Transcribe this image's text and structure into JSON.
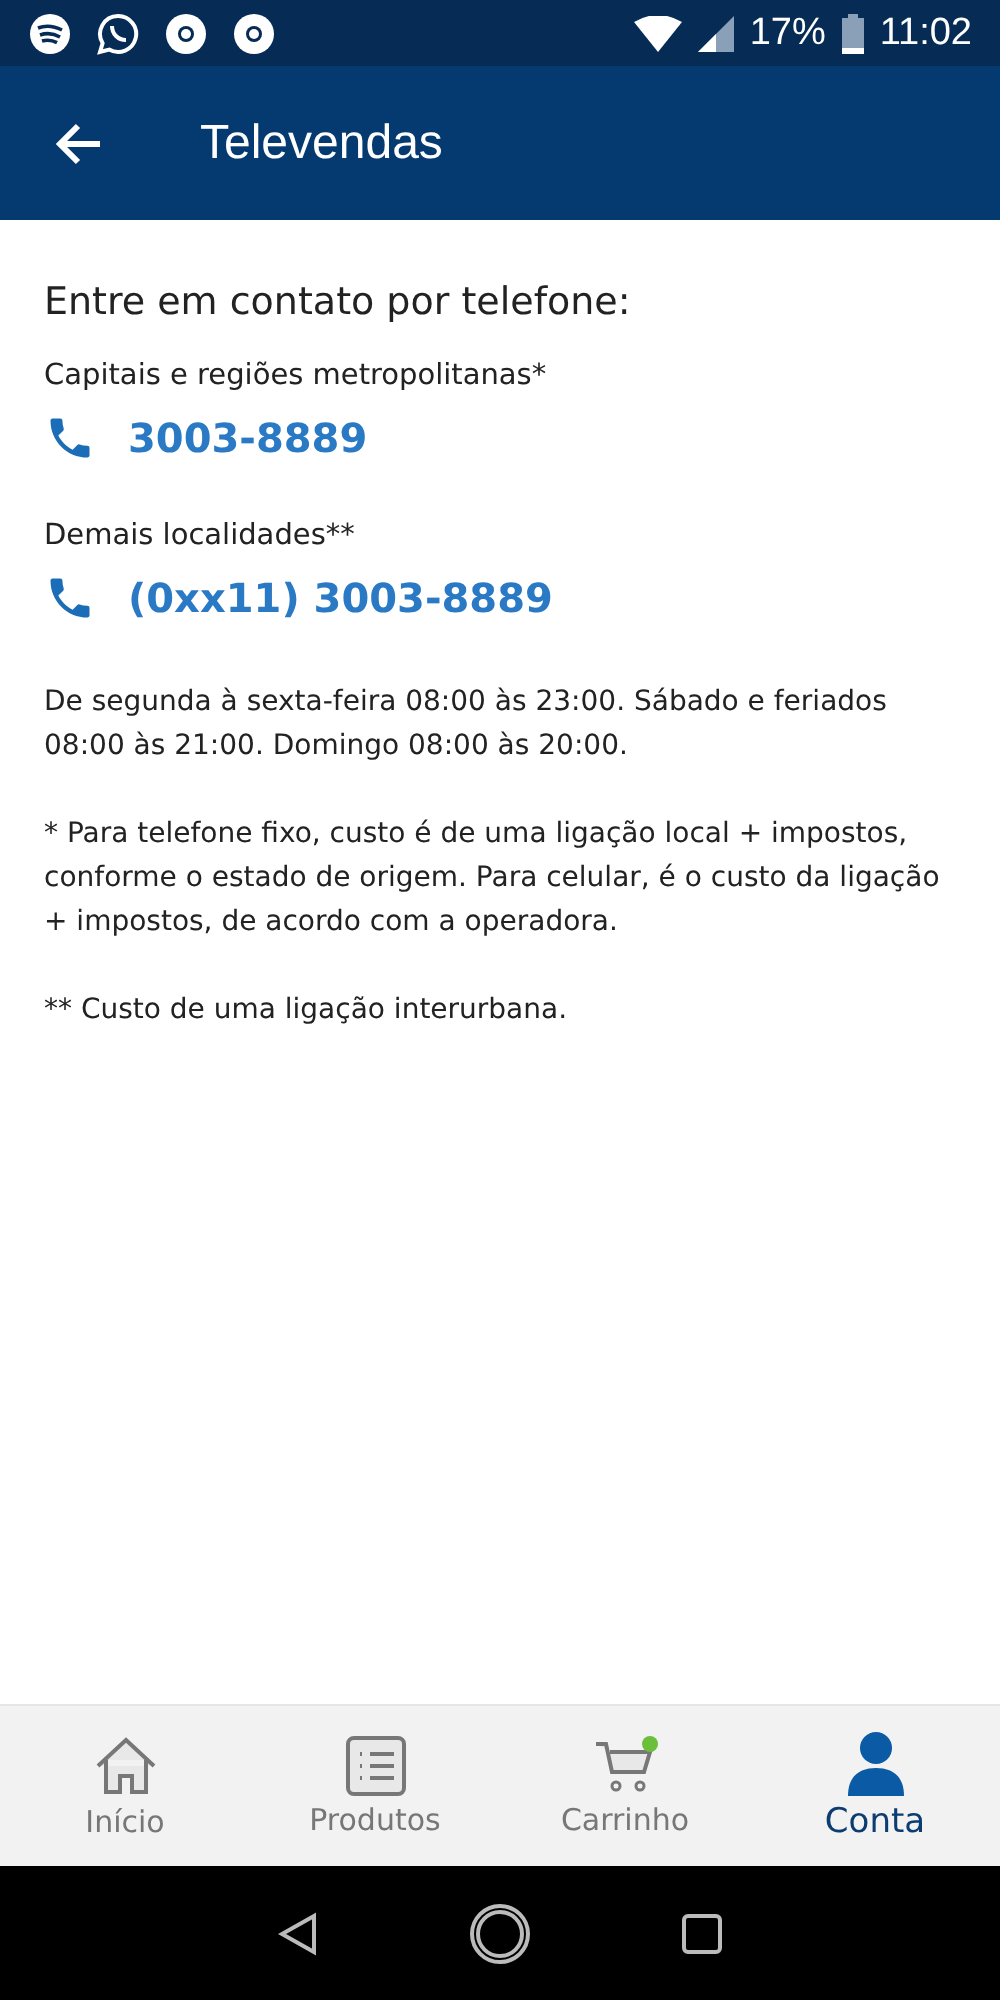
{
  "status_bar": {
    "battery": "17%",
    "time": "11:02"
  },
  "app_bar": {
    "title": "Televendas"
  },
  "content": {
    "heading": "Entre em contato por telefone:",
    "phones": [
      {
        "label": "Capitais e regiões metropolitanas*",
        "number": "3003-8889"
      },
      {
        "label": "Demais localidades**",
        "number": "(0xx11) 3003-8889"
      }
    ],
    "notes": [
      "De segunda à sexta-feira 08:00 às 23:00. Sábado e feriados 08:00 às 21:00. Domingo 08:00 às 20:00.",
      "* Para telefone fixo, custo é de uma ligação local + impostos, conforme o estado de origem. Para celular, é o custo da ligação + impostos, de acordo com a operadora.",
      "** Custo de uma ligação interurbana."
    ]
  },
  "bottom_nav": [
    {
      "kind": "home",
      "label": "Início",
      "selected": false
    },
    {
      "kind": "list",
      "label": "Produtos",
      "selected": false
    },
    {
      "kind": "cart",
      "label": "Carrinho",
      "selected": false
    },
    {
      "kind": "person",
      "label": "Conta",
      "selected": true
    }
  ]
}
